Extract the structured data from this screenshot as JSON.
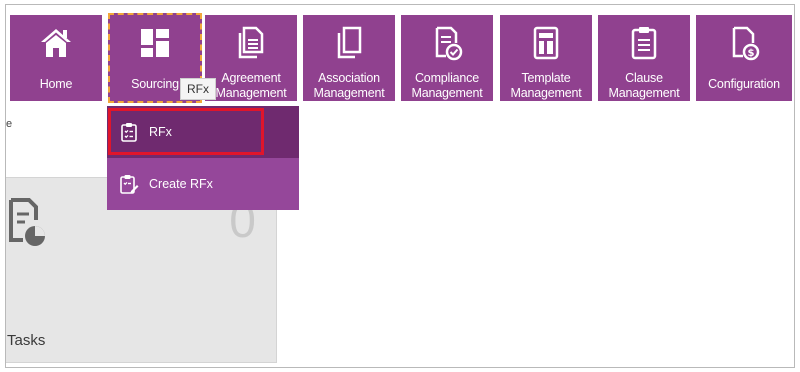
{
  "nav": {
    "home": {
      "label": "Home",
      "icon": "home-icon"
    },
    "sourcing": {
      "label": "Sourcing",
      "icon": "grid-icon"
    },
    "agreement": {
      "label": "Agreement\nManagement",
      "icon": "documents-icon"
    },
    "association": {
      "label": "Association\nManagement",
      "icon": "copy-icon"
    },
    "compliance": {
      "label": "Compliance\nManagement",
      "icon": "document-check-icon"
    },
    "template": {
      "label": "Template\nManagement",
      "icon": "template-icon"
    },
    "clause": {
      "label": "Clause\nManagement",
      "icon": "clipboard-icon"
    },
    "configuration": {
      "label": "Configuration",
      "icon": "document-dollar-icon"
    }
  },
  "tooltip": "RFx",
  "stray_text": "e",
  "dropdown": {
    "items": [
      {
        "label": "RFx",
        "icon": "clipboard-list-icon"
      },
      {
        "label": "Create RFx",
        "icon": "clipboard-edit-icon"
      }
    ]
  },
  "card": {
    "count": "0",
    "label": "Tasks"
  },
  "colors": {
    "tile": "#90418f",
    "dropdown_active": "#6f2a6f",
    "dropdown_item": "#95479a",
    "highlight": "#e0152b",
    "focus_border": "#f2a73a"
  }
}
